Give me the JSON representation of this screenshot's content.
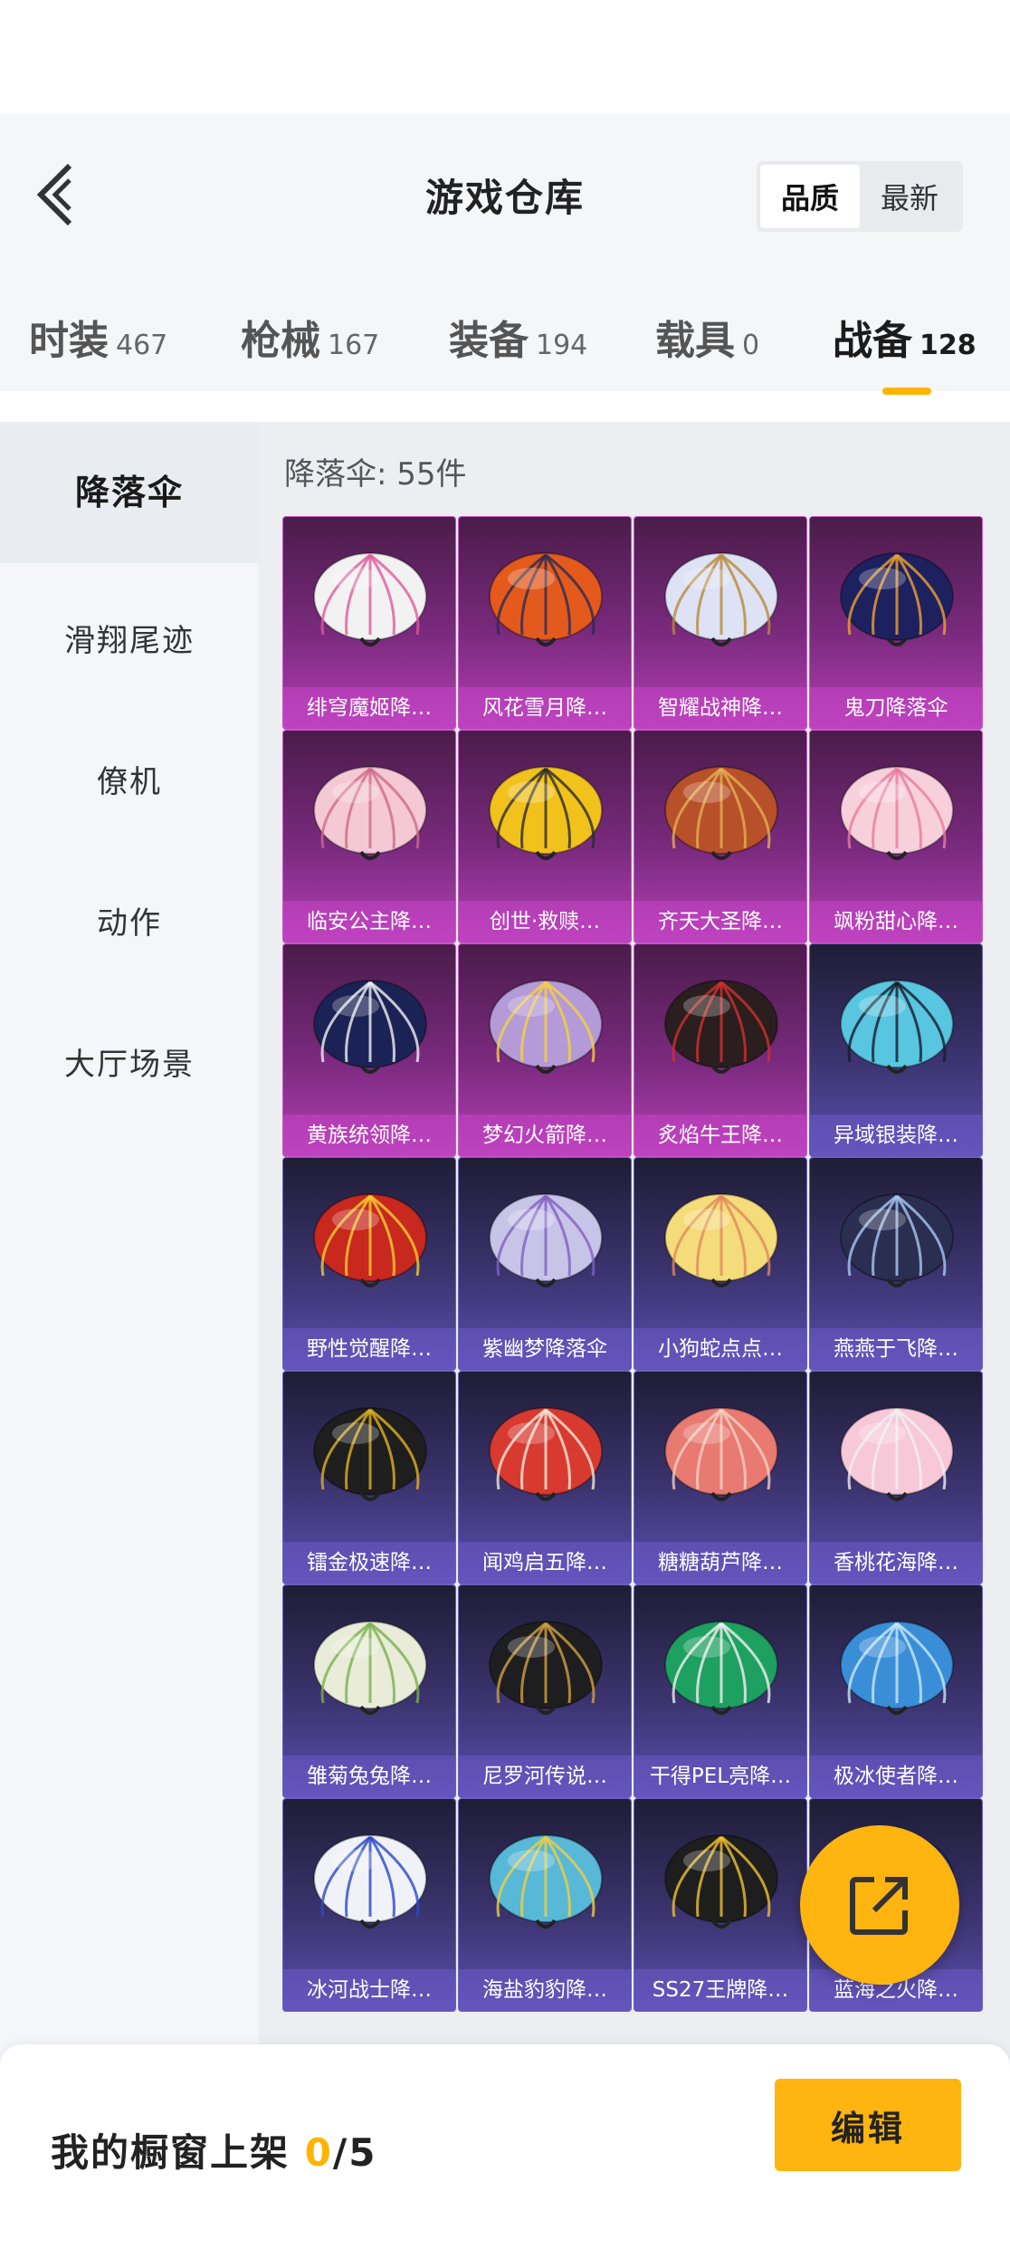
{
  "header": {
    "title": "游戏仓库",
    "sort_options": [
      "品质",
      "最新"
    ],
    "active_sort": "品质"
  },
  "tabs": [
    {
      "label": "时装",
      "count": "467"
    },
    {
      "label": "枪械",
      "count": "167"
    },
    {
      "label": "装备",
      "count": "194"
    },
    {
      "label": "载具",
      "count": "0"
    },
    {
      "label": "战备",
      "count": "128",
      "active": true
    }
  ],
  "sidebar": {
    "items": [
      "降落伞",
      "滑翔尾迹",
      "僚机",
      "动作",
      "大厅场景"
    ],
    "active": "降落伞"
  },
  "content": {
    "count_label": "降落伞: 55件",
    "items": [
      {
        "name": "绯穹魔姬降…",
        "tier": "purple",
        "color": "#f2f2f2",
        "accent": "#e05a9a"
      },
      {
        "name": "风花雪月降…",
        "tier": "purple",
        "color": "#e45a1c",
        "accent": "#2a2a55"
      },
      {
        "name": "智耀战神降…",
        "tier": "purple",
        "color": "#dde2f5",
        "accent": "#b98a3a"
      },
      {
        "name": "鬼刀降落伞",
        "tier": "purple",
        "color": "#1d2160",
        "accent": "#f0a030"
      },
      {
        "name": "临安公主降…",
        "tier": "purple",
        "color": "#f4c8d4",
        "accent": "#d06a8a"
      },
      {
        "name": "创世·救赎…",
        "tier": "purple",
        "color": "#f2c21c",
        "accent": "#2a2a30"
      },
      {
        "name": "齐天大圣降…",
        "tier": "purple",
        "color": "#b8502a",
        "accent": "#e2b050"
      },
      {
        "name": "飒粉甜心降…",
        "tier": "purple",
        "color": "#f7d0dc",
        "accent": "#e87aa0"
      },
      {
        "name": "黄族统领降…",
        "tier": "purple",
        "color": "#1b2356",
        "accent": "#f0f0f0"
      },
      {
        "name": "梦幻火箭降…",
        "tier": "purple",
        "color": "#b59ad8",
        "accent": "#f4d23c"
      },
      {
        "name": "炙焰牛王降…",
        "tier": "purple",
        "color": "#2a1e1e",
        "accent": "#d03030"
      },
      {
        "name": "异域银装降…",
        "tier": "blue",
        "color": "#58c6e0",
        "accent": "#1a1a2a"
      },
      {
        "name": "野性觉醒降…",
        "tier": "blue",
        "color": "#c8281e",
        "accent": "#f4d030"
      },
      {
        "name": "紫幽梦降落伞",
        "tier": "blue",
        "color": "#c8c4e8",
        "accent": "#8060c0"
      },
      {
        "name": "小狗蛇点点…",
        "tier": "blue",
        "color": "#f4dc7a",
        "accent": "#e08a5a"
      },
      {
        "name": "燕燕于飞降…",
        "tier": "blue",
        "color": "#2a2e50",
        "accent": "#a8c8f0"
      },
      {
        "name": "镭金极速降…",
        "tier": "blue",
        "color": "#1e1e1e",
        "accent": "#e0b020"
      },
      {
        "name": "闻鸡启五降…",
        "tier": "blue",
        "color": "#d83a30",
        "accent": "#f4e8d8"
      },
      {
        "name": "糖糖葫芦降…",
        "tier": "blue",
        "color": "#e87a72",
        "accent": "#f4d0c0"
      },
      {
        "name": "香桃花海降…",
        "tier": "blue",
        "color": "#f6c8d8",
        "accent": "#f0f0f0"
      },
      {
        "name": "雏菊兔兔降…",
        "tier": "blue",
        "color": "#e8ecd8",
        "accent": "#7ab050"
      },
      {
        "name": "尼罗河传说…",
        "tier": "blue",
        "color": "#1e1e20",
        "accent": "#d0a040"
      },
      {
        "name": "干得PEL亮降…",
        "tier": "blue",
        "color": "#1ea060",
        "accent": "#f0f0f0"
      },
      {
        "name": "极冰使者降…",
        "tier": "blue",
        "color": "#3a8ed8",
        "accent": "#c8e8f8"
      },
      {
        "name": "冰河战士降…",
        "tier": "blue",
        "color": "#f0f2f8",
        "accent": "#2a48c8"
      },
      {
        "name": "海盐豹豹降…",
        "tier": "blue",
        "color": "#58b8d8",
        "accent": "#f0d040"
      },
      {
        "name": "SS27王牌降…",
        "tier": "blue",
        "color": "#1e1e1e",
        "accent": "#f0c030"
      },
      {
        "name": "蓝海之火降…",
        "tier": "blue",
        "color": "#2a3a8a",
        "accent": "#f06a30"
      }
    ]
  },
  "footer": {
    "showcase_label": "我的橱窗上架",
    "showcase_current": "0",
    "showcase_total": "/5",
    "edit_label": "编辑"
  }
}
